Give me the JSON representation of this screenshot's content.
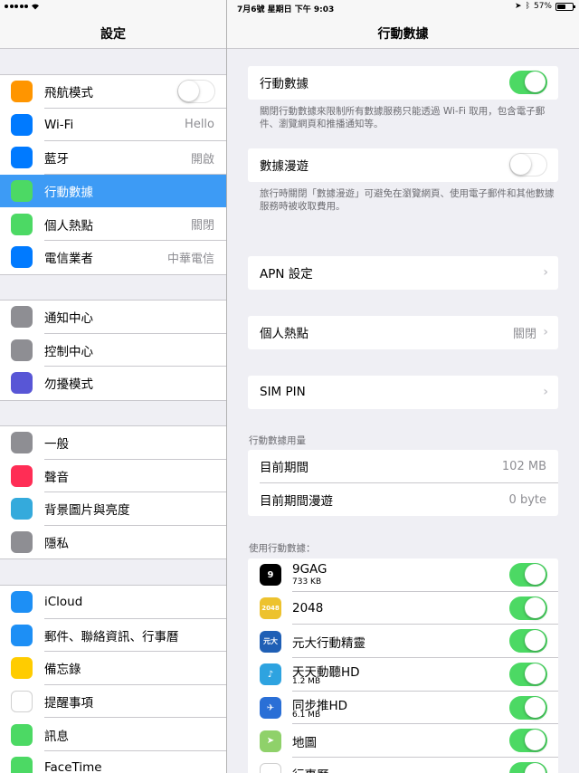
{
  "status": {
    "time": "7月6號  星期日 下午 9:03",
    "battery": "57%",
    "battery_level": 0.57
  },
  "left": {
    "title": "設定",
    "groups": [
      {
        "items": [
          {
            "label": "飛航模式",
            "icon": "airplane-icon",
            "color": "#ff9500",
            "toggle": false
          },
          {
            "label": "Wi-Fi",
            "icon": "wifi-icon",
            "color": "#007aff",
            "value": "Hello"
          },
          {
            "label": "藍牙",
            "icon": "bluetooth-icon",
            "color": "#007aff",
            "value": "開啟"
          },
          {
            "label": "行動數據",
            "icon": "cellular-icon",
            "color": "#4cd964",
            "selected": true
          },
          {
            "label": "個人熱點",
            "icon": "hotspot-icon",
            "color": "#4cd964",
            "value": "關閉"
          },
          {
            "label": "電信業者",
            "icon": "phone-icon",
            "color": "#007aff",
            "value": "中華電信"
          }
        ]
      },
      {
        "items": [
          {
            "label": "通知中心",
            "icon": "notification-icon",
            "color": "#8e8e93"
          },
          {
            "label": "控制中心",
            "icon": "control-center-icon",
            "color": "#8e8e93"
          },
          {
            "label": "勿擾模式",
            "icon": "moon-icon",
            "color": "#5856d6"
          }
        ]
      },
      {
        "items": [
          {
            "label": "一般",
            "icon": "gear-icon",
            "color": "#8e8e93"
          },
          {
            "label": "聲音",
            "icon": "speaker-icon",
            "color": "#ff2d55"
          },
          {
            "label": "背景圖片與亮度",
            "icon": "flower-icon",
            "color": "#34aadc"
          },
          {
            "label": "隱私",
            "icon": "hand-icon",
            "color": "#8e8e93"
          }
        ]
      },
      {
        "items": [
          {
            "label": "iCloud",
            "icon": "cloud-icon",
            "color": "#1d8ff5"
          },
          {
            "label": "郵件、聯絡資訊、行事曆",
            "icon": "mail-icon",
            "color": "#1d8ff5"
          },
          {
            "label": "備忘錄",
            "icon": "notes-icon",
            "color": "#ffcc00"
          },
          {
            "label": "提醒事項",
            "icon": "list-icon",
            "color": "#ffffff"
          },
          {
            "label": "訊息",
            "icon": "message-icon",
            "color": "#4cd964"
          },
          {
            "label": "FaceTime",
            "icon": "video-icon",
            "color": "#4cd964"
          }
        ]
      }
    ]
  },
  "right": {
    "title": "行動數據",
    "cellular": {
      "label": "行動數據",
      "on": true
    },
    "cellular_note": "關閉行動數據來限制所有數據服務只能透過 Wi-Fi 取用，包含電子郵件、瀏覽網頁和推播通知等。",
    "roaming": {
      "label": "數據漫遊",
      "on": false
    },
    "roaming_note": "旅行時關閉「數據漫遊」可避免在瀏覽網頁、使用電子郵件和其他數據服務時被收取費用。",
    "apn": {
      "label": "APN 設定",
      "chevron": "›"
    },
    "hotspot": {
      "label": "個人熱點",
      "value": "關閉",
      "chevron": "›"
    },
    "sim": {
      "label": "SIM PIN",
      "chevron": "›"
    },
    "usage_header": "行動數據用量",
    "usage": [
      {
        "label": "目前期間",
        "value": "102 MB"
      },
      {
        "label": "目前期間漫遊",
        "value": "0 byte"
      }
    ],
    "apps_header": "使用行動數據：",
    "apps": [
      {
        "name": "9GAG",
        "size": "733 KB",
        "icon": "9gag-icon",
        "glyph": "9",
        "color": "#000000",
        "on": true
      },
      {
        "name": "2048",
        "size": "",
        "icon": "2048-icon",
        "glyph": "2048",
        "color": "#edc22e",
        "on": true
      },
      {
        "name": "元大行動精靈",
        "size": "",
        "icon": "yuanta-icon",
        "glyph": "元大",
        "color": "#1f5fb5",
        "on": true
      },
      {
        "name": "天天動聽HD",
        "size": "1.2 MB",
        "icon": "ttpod-icon",
        "glyph": "♪",
        "color": "#2ea3e0",
        "on": true
      },
      {
        "name": "同步推HD",
        "size": "6.1 MB",
        "icon": "tongbu-icon",
        "glyph": "✈",
        "color": "#2a6fd6",
        "on": true
      },
      {
        "name": "地圖",
        "size": "",
        "icon": "maps-icon",
        "glyph": "➤",
        "color": "#8fd16a",
        "on": true
      },
      {
        "name": "行事曆",
        "size": "",
        "icon": "calendar-icon",
        "glyph": "",
        "color": "#ffffff",
        "on": true
      }
    ]
  }
}
